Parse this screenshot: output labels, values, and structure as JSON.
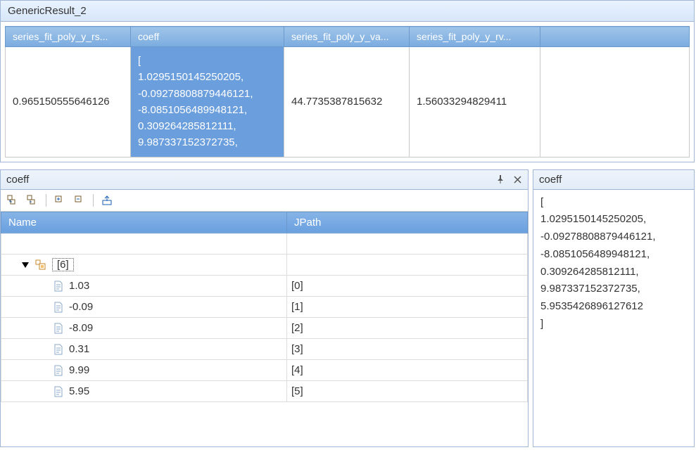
{
  "top": {
    "title": "GenericResult_2",
    "columns": [
      "series_fit_poly_y_rs...",
      "coeff",
      "series_fit_poly_y_va...",
      "series_fit_poly_y_rv...",
      ""
    ],
    "row": {
      "c0": "0.965150555646126",
      "c1": "[\n  1.0295150145250205,\n  -0.09278808879446121,\n  -8.0851056489948121,\n  0.309264285812111,\n  9.987337152372735,",
      "c2": "44.7735387815632",
      "c3": "1.56033294829411",
      "c4": ""
    }
  },
  "tree": {
    "title": "coeff",
    "cols": [
      "Name",
      "JPath"
    ],
    "root": "[6]",
    "items": [
      {
        "name": "1.03",
        "path": "[0]"
      },
      {
        "name": "-0.09",
        "path": "[1]"
      },
      {
        "name": "-8.09",
        "path": "[2]"
      },
      {
        "name": "0.31",
        "path": "[3]"
      },
      {
        "name": "9.99",
        "path": "[4]"
      },
      {
        "name": "5.95",
        "path": "[5]"
      }
    ]
  },
  "detail": {
    "title": "coeff",
    "text": "[\n  1.0295150145250205,\n  -0.09278808879446121,\n  -8.0851056489948121,\n  0.309264285812111,\n  9.987337152372735,\n  5.9535426896127612\n]"
  }
}
